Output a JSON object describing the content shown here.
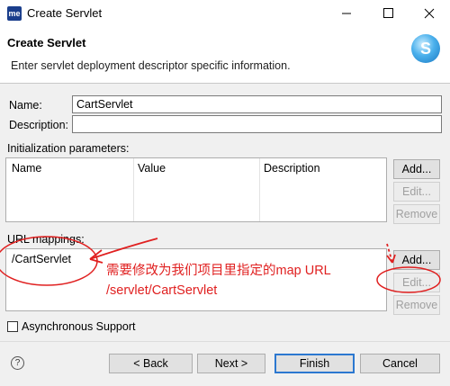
{
  "window": {
    "title": "Create Servlet",
    "app_icon_text": "me"
  },
  "banner": {
    "title": "Create Servlet",
    "description": "Enter servlet deployment descriptor specific information."
  },
  "form": {
    "name_label": "Name:",
    "name_value": "CartServlet",
    "description_label": "Description:",
    "description_value": ""
  },
  "init_params": {
    "label": "Initialization parameters:",
    "columns": [
      "Name",
      "Value",
      "Description"
    ],
    "buttons": {
      "add": "Add...",
      "edit": "Edit...",
      "remove": "Remove"
    }
  },
  "url_mappings": {
    "label": "URL mappings:",
    "items": [
      "/CartServlet"
    ],
    "buttons": {
      "add": "Add...",
      "edit": "Edit...",
      "remove": "Remove"
    }
  },
  "annotation": {
    "line1": "需要修改为我们项目里指定的map URL",
    "line2": "/servlet/CartServlet",
    "color": "#e02020"
  },
  "async": {
    "label": "Asynchronous Support",
    "checked": false
  },
  "footer": {
    "back": "< Back",
    "next": "Next >",
    "finish": "Finish",
    "cancel": "Cancel",
    "help_icon_text": "?"
  }
}
